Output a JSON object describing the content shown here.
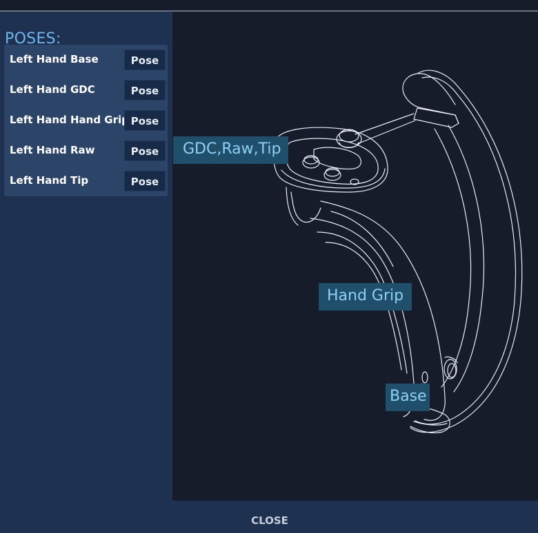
{
  "poses": {
    "title": "POSES:",
    "items": [
      {
        "label": "Left Hand Base",
        "button": "Pose"
      },
      {
        "label": "Left Hand GDC",
        "button": "Pose"
      },
      {
        "label": "Left Hand Hand Grip",
        "button": "Pose"
      },
      {
        "label": "Left Hand Raw",
        "button": "Pose"
      },
      {
        "label": "Left Hand Tip",
        "button": "Pose"
      }
    ]
  },
  "viewport": {
    "callouts": {
      "gdc_raw_tip": "GDC,Raw,Tip",
      "hand_grip": "Hand Grip",
      "base": "Base"
    }
  },
  "footer": {
    "close_label": "CLOSE"
  },
  "colors": {
    "background": "#1f2f4b",
    "panel": "#2c4468",
    "viewport": "#171c2a",
    "accent_text": "#6db7ee",
    "callout_bg": "#1f4f6a"
  }
}
